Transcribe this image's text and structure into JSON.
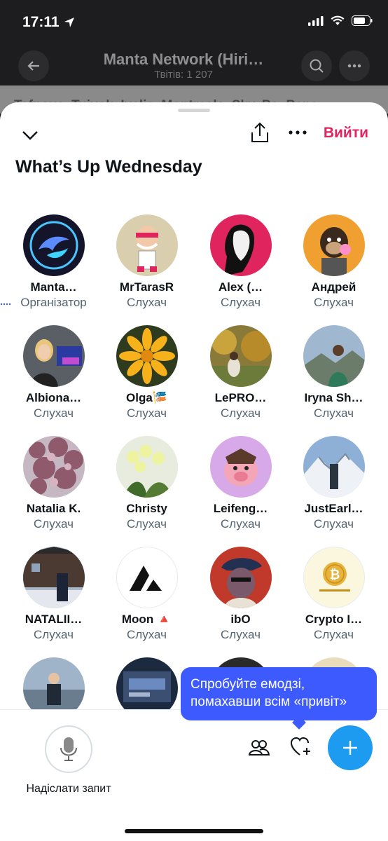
{
  "status": {
    "time": "17:11"
  },
  "background": {
    "title": "Manta Network (Hiri…",
    "subtitle": "Твітів: 1 207",
    "strip_text": "Tafnova, Tuiyok, Ivelia, Montreals, Sky, Po, Pepe…"
  },
  "sheet": {
    "leave_label": "Вийти",
    "space_title": "What’s Up Wednesday"
  },
  "participants": [
    {
      "name": "Manta…",
      "role": "Організатор",
      "avatar": "manta-logo"
    },
    {
      "name": "MrTarasR",
      "role": "Слухач",
      "avatar": "cartoon-man"
    },
    {
      "name": "Alex (…",
      "role": "Слухач",
      "avatar": "statue"
    },
    {
      "name": "Андрей",
      "role": "Слухач",
      "avatar": "ape-nft"
    },
    {
      "name": "Albiona…",
      "role": "Слухач",
      "avatar": "woman-desk"
    },
    {
      "name": "Olga🎏",
      "role": "Слухач",
      "avatar": "yellow-flower"
    },
    {
      "name": "LePRO…",
      "role": "Слухач",
      "avatar": "autumn-forest"
    },
    {
      "name": "Iryna Sh…",
      "role": "Слухач",
      "avatar": "mountain-person"
    },
    {
      "name": "Natalia K.",
      "role": "Слухач",
      "avatar": "pink-blossom"
    },
    {
      "name": "Christy",
      "role": "Слухач",
      "avatar": "orchids"
    },
    {
      "name": "Leifeng…",
      "role": "Слухач",
      "avatar": "cartoon-pig"
    },
    {
      "name": "JustEarl…",
      "role": "Слухач",
      "avatar": "snow-mountain"
    },
    {
      "name": "NATALII…",
      "role": "Слухач",
      "avatar": "winter-house"
    },
    {
      "name": "Moon 🔺",
      "role": "Слухач",
      "avatar": "avalanche-logo"
    },
    {
      "name": "ibO",
      "role": "Слухач",
      "avatar": "pirate-nft"
    },
    {
      "name": "Crypto I…",
      "role": "Слухач",
      "avatar": "bitcoin-coin"
    },
    {
      "name": "",
      "role": "",
      "avatar": "man-seaside"
    },
    {
      "name": "",
      "role": "",
      "avatar": "computer-screen"
    },
    {
      "name": "",
      "role": "",
      "avatar": "dark-photo"
    },
    {
      "name": "",
      "role": "",
      "avatar": "beige-photo"
    }
  ],
  "tooltip": {
    "text": "Спробуйте емодзі, помахавши всім «привіт»"
  },
  "bottom_bar": {
    "request_label": "Надіслати запит"
  },
  "colors": {
    "accent": "#1d9bf0",
    "leave": "#e0245e",
    "tooltip": "#3d5afe"
  }
}
